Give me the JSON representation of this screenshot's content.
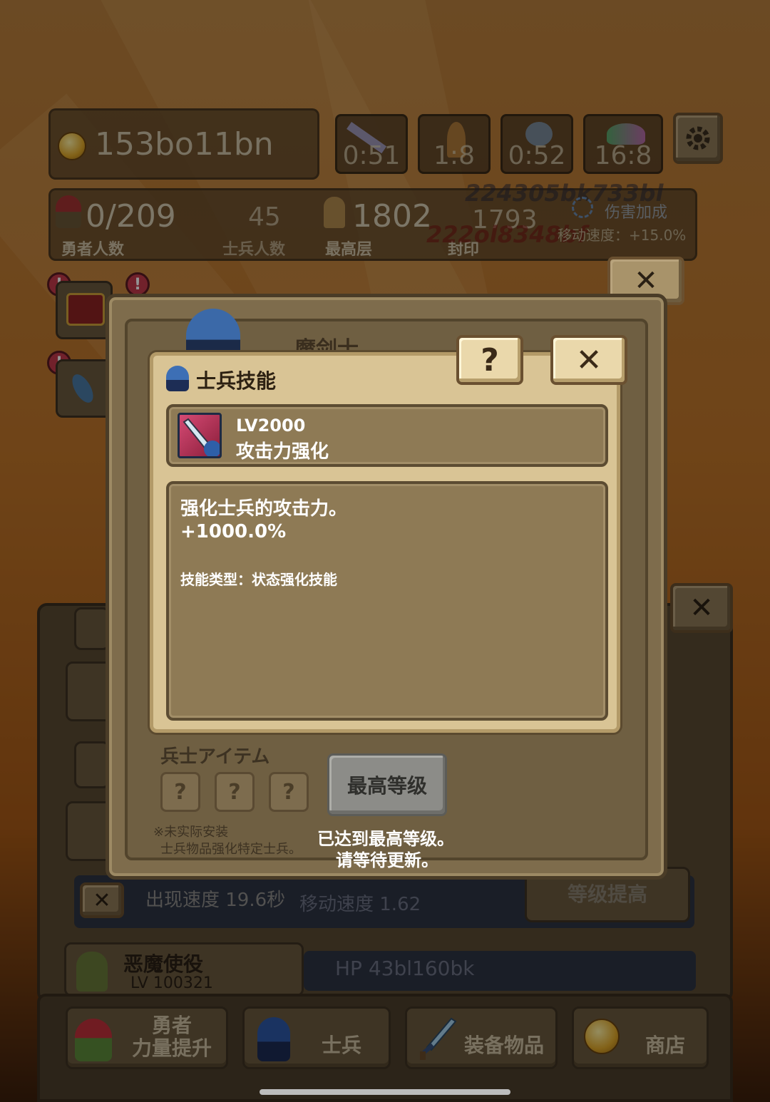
{
  "hud": {
    "gold": "153bo11bn",
    "timers": [
      "0:51",
      "1:8",
      "0:52",
      "16:8"
    ],
    "stats": [
      {
        "value": "0/209",
        "label": "勇者人数"
      },
      {
        "value": "45",
        "label": "士兵人数"
      },
      {
        "value": "1802",
        "label": "最高层"
      },
      {
        "value": "1793",
        "label": "封印"
      }
    ],
    "buff": {
      "line1": "伤害加成",
      "line2": "移动速度：+15.0%"
    },
    "damage_popups": [
      "224305bk733bl",
      "222ol8348bf"
    ]
  },
  "outer_dialog": {
    "title": "魔剑士",
    "items_title": "兵士アイテム",
    "item_slots": [
      "?",
      "?",
      "?"
    ],
    "note_line1": "※未实际安装",
    "note_line2": "士兵物品强化特定士兵。",
    "max_level_button": "最高等级",
    "max_level_msg1": "已达到最高等级。",
    "max_level_msg2": "请等待更新。"
  },
  "skill_dialog": {
    "title": "士兵技能",
    "help_label": "?",
    "close_label": "✕",
    "level": "LV2000",
    "skill_name": "攻击力强化",
    "desc_line1": "强化士兵的攻击力。",
    "desc_line2": "+1000.0%",
    "skill_type": "技能类型：状态强化技能"
  },
  "background_list": {
    "spawn_speed": "出现速度  19.6秒",
    "move_speed": "移动速度 1.62",
    "level_up": "等级提高",
    "devil_name": "恶魔使役",
    "devil_level": "LV 100321",
    "devil_hp": "HP 43bl160bk"
  },
  "nav": [
    {
      "line1": "勇者",
      "line2": "力量提升"
    },
    {
      "line1": "",
      "line2": "士兵"
    },
    {
      "line1": "",
      "line2": "装备物品"
    },
    {
      "line1": "",
      "line2": "商店"
    }
  ],
  "colors": {
    "dialog_bg": "#d9c495",
    "card_bg": "#8e7a55",
    "alert_red": "#c33a4b"
  }
}
